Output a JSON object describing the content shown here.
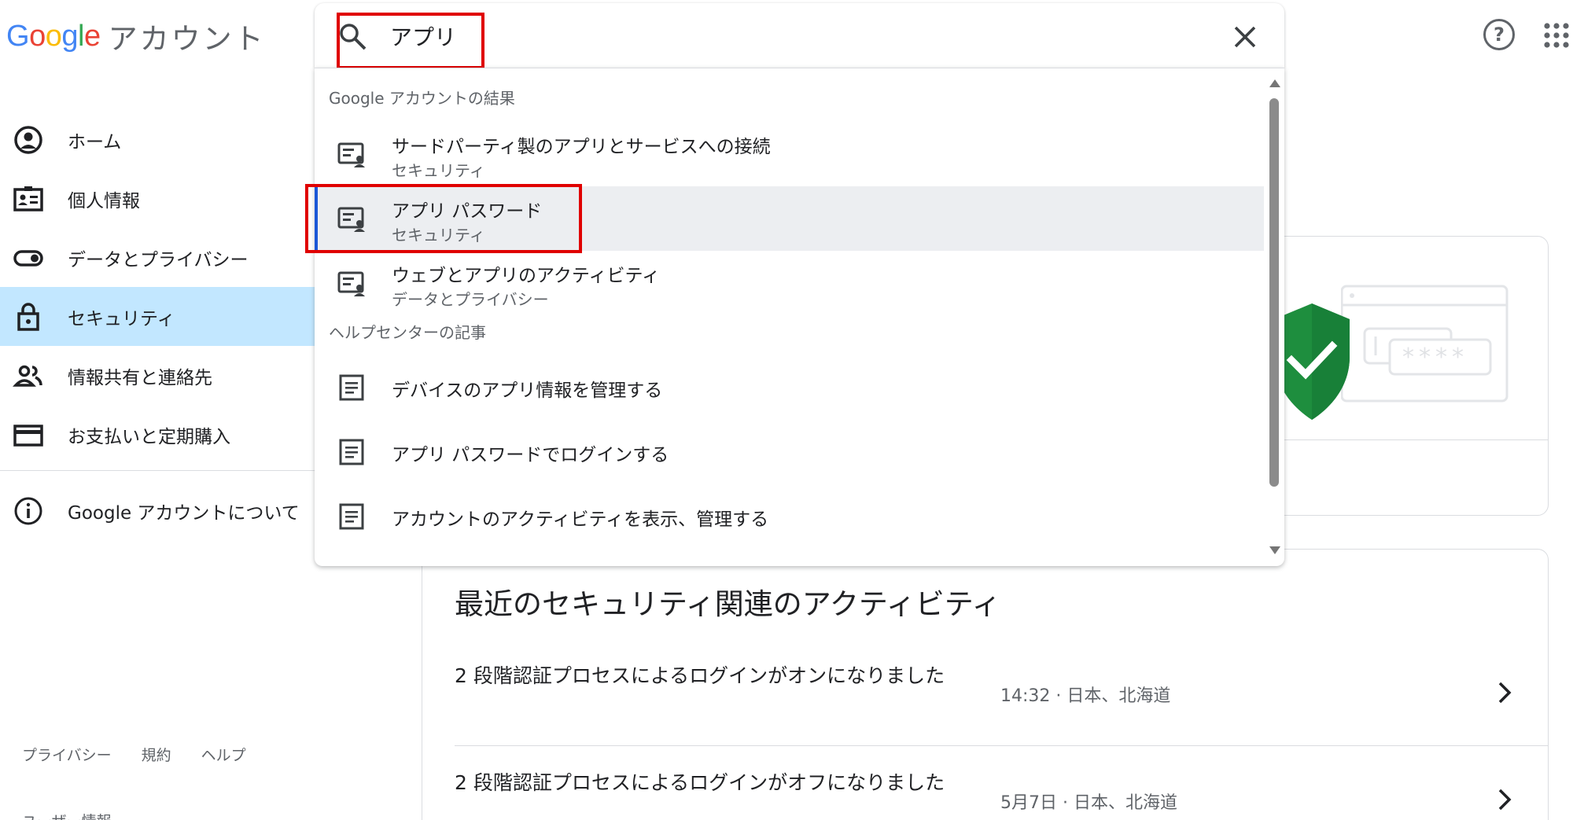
{
  "header": {
    "logo_letters": [
      {
        "char": "G",
        "color": "#4285F4"
      },
      {
        "char": "o",
        "color": "#EA4335"
      },
      {
        "char": "o",
        "color": "#FBBC05"
      },
      {
        "char": "g",
        "color": "#4285F4"
      },
      {
        "char": "l",
        "color": "#34A853"
      },
      {
        "char": "e",
        "color": "#EA4335"
      }
    ],
    "product_name": "アカウント",
    "help_label": "?",
    "help_icon": "help-circle-icon",
    "apps_icon": "apps-grid-icon"
  },
  "search": {
    "value": "アプリ",
    "search_icon": "search-icon",
    "clear_icon": "close-icon",
    "sections": [
      {
        "header": "Google アカウントの結果"
      },
      {
        "header": "ヘルプセンターの記事"
      }
    ],
    "results": [
      {
        "title": "サードパーティ製のアプリとサービスへの接続",
        "subtitle": "セキュリティ",
        "icon": "settings-account-icon"
      },
      {
        "title": "アプリ パスワード",
        "subtitle": "セキュリティ",
        "icon": "settings-account-icon",
        "selected": true
      },
      {
        "title": "ウェブとアプリのアクティビティ",
        "subtitle": "データとプライバシー",
        "icon": "settings-account-icon"
      }
    ],
    "articles": [
      {
        "title": "デバイスのアプリ情報を管理する",
        "icon": "article-icon"
      },
      {
        "title": "アプリ パスワードでログインする",
        "icon": "article-icon"
      },
      {
        "title": "アカウントのアクティビティを表示、管理する",
        "icon": "article-icon"
      }
    ],
    "highlight_color": "#e00000"
  },
  "sidebar": {
    "items": [
      {
        "label": "ホーム",
        "icon": "account-circle-icon"
      },
      {
        "label": "個人情報",
        "icon": "id-card-icon"
      },
      {
        "label": "データとプライバシー",
        "icon": "toggle-icon"
      },
      {
        "label": "セキュリティ",
        "icon": "lock-icon",
        "active": true
      },
      {
        "label": "情報共有と連絡先",
        "icon": "people-icon"
      },
      {
        "label": "お支払いと定期購入",
        "icon": "credit-card-icon"
      }
    ],
    "about": {
      "label": "Google アカウントについて",
      "icon": "info-icon"
    },
    "active_color": "#c2e7ff"
  },
  "footer": {
    "links": [
      "プライバシー",
      "規約",
      "ヘルプ"
    ],
    "user_info": "ユーザー情報"
  },
  "main": {
    "illustration_password_mask": "****",
    "recent_activity": {
      "title": "最近のセキュリティ関連のアクティビティ",
      "rows": [
        {
          "text": "2 段階認証プロセスによるログインがオンになりました",
          "meta": "14:32 · 日本、北海道"
        },
        {
          "text": "2 段階認証プロセスによるログインがオフになりました",
          "meta": "5月7日 · 日本、北海道"
        }
      ]
    }
  }
}
